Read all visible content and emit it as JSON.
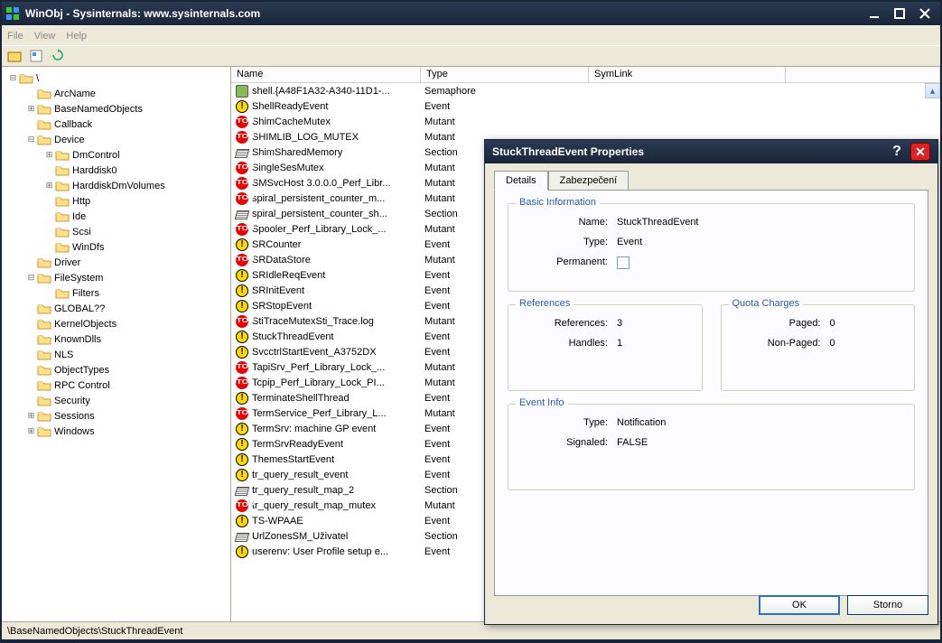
{
  "window": {
    "title": "WinObj - Sysinternals: www.sysinternals.com"
  },
  "menu": {
    "items": [
      "File",
      "View",
      "Help"
    ]
  },
  "tree": [
    {
      "depth": 0,
      "exp": "-",
      "label": "\\"
    },
    {
      "depth": 1,
      "exp": "",
      "label": "ArcName"
    },
    {
      "depth": 1,
      "exp": "+",
      "label": "BaseNamedObjects"
    },
    {
      "depth": 1,
      "exp": "",
      "label": "Callback"
    },
    {
      "depth": 1,
      "exp": "-",
      "label": "Device"
    },
    {
      "depth": 2,
      "exp": "+",
      "label": "DmControl"
    },
    {
      "depth": 2,
      "exp": "",
      "label": "Harddisk0"
    },
    {
      "depth": 2,
      "exp": "+",
      "label": "HarddiskDmVolumes"
    },
    {
      "depth": 2,
      "exp": "",
      "label": "Http"
    },
    {
      "depth": 2,
      "exp": "",
      "label": "Ide"
    },
    {
      "depth": 2,
      "exp": "",
      "label": "Scsi"
    },
    {
      "depth": 2,
      "exp": "",
      "label": "WinDfs"
    },
    {
      "depth": 1,
      "exp": "",
      "label": "Driver"
    },
    {
      "depth": 1,
      "exp": "-",
      "label": "FileSystem"
    },
    {
      "depth": 2,
      "exp": "",
      "label": "Filters"
    },
    {
      "depth": 1,
      "exp": "",
      "label": "GLOBAL??"
    },
    {
      "depth": 1,
      "exp": "",
      "label": "KernelObjects"
    },
    {
      "depth": 1,
      "exp": "",
      "label": "KnownDlls"
    },
    {
      "depth": 1,
      "exp": "",
      "label": "NLS"
    },
    {
      "depth": 1,
      "exp": "",
      "label": "ObjectTypes"
    },
    {
      "depth": 1,
      "exp": "",
      "label": "RPC Control"
    },
    {
      "depth": 1,
      "exp": "",
      "label": "Security"
    },
    {
      "depth": 1,
      "exp": "+",
      "label": "Sessions"
    },
    {
      "depth": 1,
      "exp": "+",
      "label": "Windows"
    }
  ],
  "columns": {
    "name": "Name",
    "type": "Type",
    "symlink": "SymLink"
  },
  "objects": [
    {
      "name": "shell.{A48F1A32-A340-11D1-...",
      "type": "Semaphore",
      "icon": "semaphore"
    },
    {
      "name": "ShellReadyEvent",
      "type": "Event",
      "icon": "event"
    },
    {
      "name": "ShimCacheMutex",
      "type": "Mutant",
      "icon": "mutant"
    },
    {
      "name": "SHIMLIB_LOG_MUTEX",
      "type": "Mutant",
      "icon": "mutant"
    },
    {
      "name": "ShimSharedMemory",
      "type": "Section",
      "icon": "section"
    },
    {
      "name": "SingleSesMutex",
      "type": "Mutant",
      "icon": "mutant"
    },
    {
      "name": "SMSvcHost 3.0.0.0_Perf_Libr...",
      "type": "Mutant",
      "icon": "mutant"
    },
    {
      "name": "spiral_persistent_counter_m...",
      "type": "Mutant",
      "icon": "mutant"
    },
    {
      "name": "spiral_persistent_counter_sh...",
      "type": "Section",
      "icon": "section"
    },
    {
      "name": "Spooler_Perf_Library_Lock_...",
      "type": "Mutant",
      "icon": "mutant"
    },
    {
      "name": "SRCounter",
      "type": "Event",
      "icon": "event"
    },
    {
      "name": "SRDataStore",
      "type": "Mutant",
      "icon": "mutant"
    },
    {
      "name": "SRIdleReqEvent",
      "type": "Event",
      "icon": "event"
    },
    {
      "name": "SRInitEvent",
      "type": "Event",
      "icon": "event"
    },
    {
      "name": "SRStopEvent",
      "type": "Event",
      "icon": "event"
    },
    {
      "name": "StiTraceMutexSti_Trace.log",
      "type": "Mutant",
      "icon": "mutant"
    },
    {
      "name": "StuckThreadEvent",
      "type": "Event",
      "icon": "event"
    },
    {
      "name": "SvcctrlStartEvent_A3752DX",
      "type": "Event",
      "icon": "event"
    },
    {
      "name": "TapiSrv_Perf_Library_Lock_...",
      "type": "Mutant",
      "icon": "mutant"
    },
    {
      "name": "Tcpip_Perf_Library_Lock_PI...",
      "type": "Mutant",
      "icon": "mutant"
    },
    {
      "name": "TerminateShellThread",
      "type": "Event",
      "icon": "event"
    },
    {
      "name": "TermService_Perf_Library_L...",
      "type": "Mutant",
      "icon": "mutant"
    },
    {
      "name": "TermSrv:  machine GP event",
      "type": "Event",
      "icon": "event"
    },
    {
      "name": "TermSrvReadyEvent",
      "type": "Event",
      "icon": "event"
    },
    {
      "name": "ThemesStartEvent",
      "type": "Event",
      "icon": "event"
    },
    {
      "name": "tr_query_result_event",
      "type": "Event",
      "icon": "event"
    },
    {
      "name": "tr_query_result_map_2",
      "type": "Section",
      "icon": "section"
    },
    {
      "name": "tr_query_result_map_mutex",
      "type": "Mutant",
      "icon": "mutant"
    },
    {
      "name": "TS-WPAAE",
      "type": "Event",
      "icon": "event"
    },
    {
      "name": "UrlZonesSM_Uživatel",
      "type": "Section",
      "icon": "section"
    },
    {
      "name": "userenv:  User Profile setup e...",
      "type": "Event",
      "icon": "event"
    }
  ],
  "status": "\\BaseNamedObjects\\StuckThreadEvent",
  "dialog": {
    "title": "StuckThreadEvent Properties",
    "tabs": {
      "details": "Details",
      "security": "Zabezpečení"
    },
    "groups": {
      "basic": {
        "legend": "Basic Information",
        "name_label": "Name:",
        "name_value": "StuckThreadEvent",
        "type_label": "Type:",
        "type_value": "Event",
        "perm_label": "Permanent:"
      },
      "refs": {
        "legend": "References",
        "references_label": "References:",
        "references_value": "3",
        "handles_label": "Handles:",
        "handles_value": "1"
      },
      "quota": {
        "legend": "Quota Charges",
        "paged_label": "Paged:",
        "paged_value": "0",
        "nonpaged_label": "Non-Paged:",
        "nonpaged_value": "0"
      },
      "event": {
        "legend": "Event Info",
        "etype_label": "Type:",
        "etype_value": "Notification",
        "signaled_label": "Signaled:",
        "signaled_value": "FALSE"
      }
    },
    "ok": "OK",
    "cancel": "Storno"
  }
}
